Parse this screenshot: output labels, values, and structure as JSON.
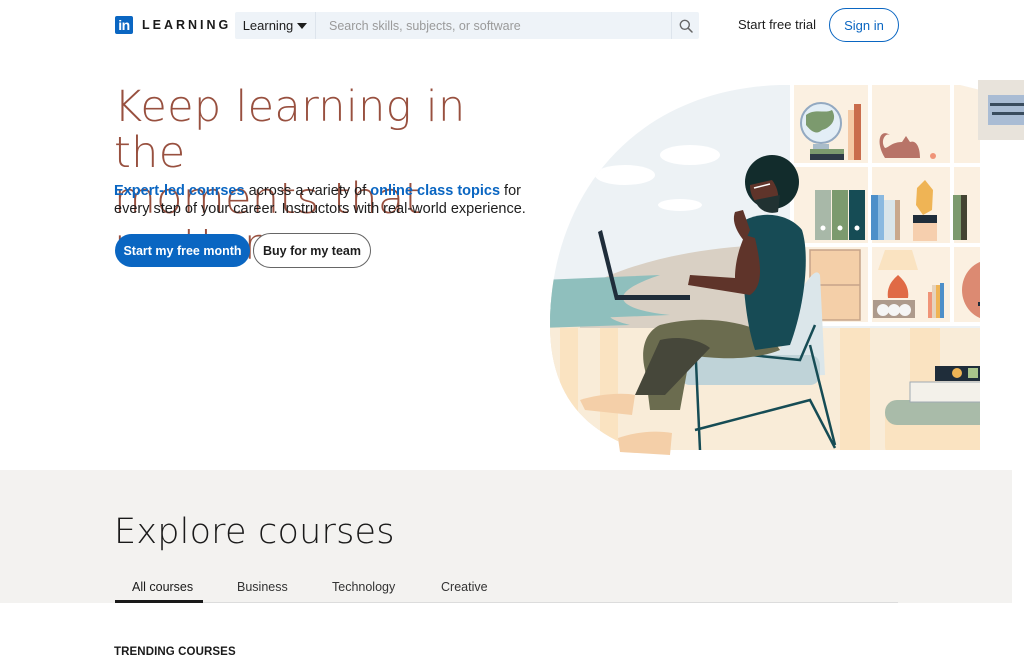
{
  "header": {
    "logo_mark": "in",
    "logo_text": "LEARNING",
    "search_category": "Learning",
    "search_placeholder": "Search skills, subjects, or software",
    "search_value": "",
    "search_icon": "search-icon",
    "start_trial_label": "Start free trial",
    "sign_in_label": "Sign in"
  },
  "hero": {
    "title_line1": "Keep learning in the",
    "title_line2": "moments that matter",
    "subtitle_link1": "Expert-led courses",
    "subtitle_text1": " across a variety of ",
    "subtitle_link2": "online class topics",
    "subtitle_text2": " for every step of your career. Instructors with real-world experience.",
    "primary_cta": "Start my free month",
    "secondary_cta": "Buy for my team",
    "illustration": "person-with-laptop-in-chair-illustration"
  },
  "explore": {
    "title": "Explore courses",
    "tabs": [
      {
        "label": "All courses",
        "active": true
      },
      {
        "label": "Business",
        "active": false
      },
      {
        "label": "Technology",
        "active": false
      },
      {
        "label": "Creative",
        "active": false
      }
    ]
  },
  "trending": {
    "heading": "TRENDING COURSES"
  },
  "colors": {
    "brand_blue": "#0a66c2",
    "title_brown": "#98503f",
    "explore_bg": "#f3f2f0",
    "search_bg": "#eef3f8"
  }
}
